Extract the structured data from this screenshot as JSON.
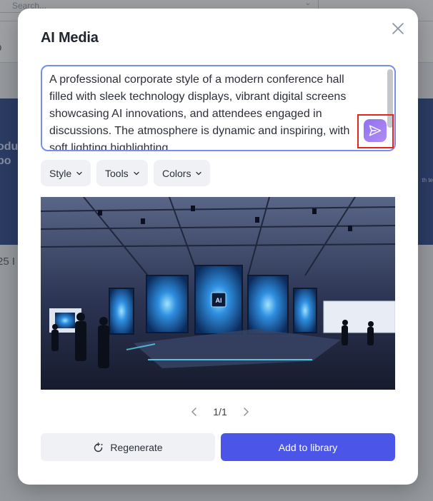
{
  "background": {
    "search_placeholder": "Search...",
    "subbar_text": "p",
    "hero_text": "odu\nbo",
    "hero_side_text": "th te",
    "count_text": "25 I"
  },
  "modal": {
    "title": "AI Media",
    "close_icon": "close-icon",
    "prompt": {
      "value": "A professional corporate style of a modern conference hall filled with sleek technology displays, vibrant digital screens showcasing AI innovations, and attendees engaged in discussions. The atmosphere is dynamic and inspiring, with soft lighting highlighting",
      "send_icon": "send-icon"
    },
    "chips": [
      {
        "label": "Style",
        "icon": "chevron-down-icon"
      },
      {
        "label": "Tools",
        "icon": "chevron-down-icon"
      },
      {
        "label": "Colors",
        "icon": "chevron-down-icon"
      }
    ],
    "image": {
      "chip_label": "AI"
    },
    "pager": {
      "count": "1/1",
      "prev_icon": "chevron-left-icon",
      "next_icon": "chevron-right-icon"
    },
    "regenerate_label": "Regenerate",
    "regenerate_icon": "refresh-sparkle-icon",
    "add_label": "Add to library"
  },
  "colors": {
    "accent": "#4b56e8",
    "send_gradient_start": "#8f72f2",
    "send_gradient_end": "#b18cf0",
    "highlight": "#e5251b"
  }
}
